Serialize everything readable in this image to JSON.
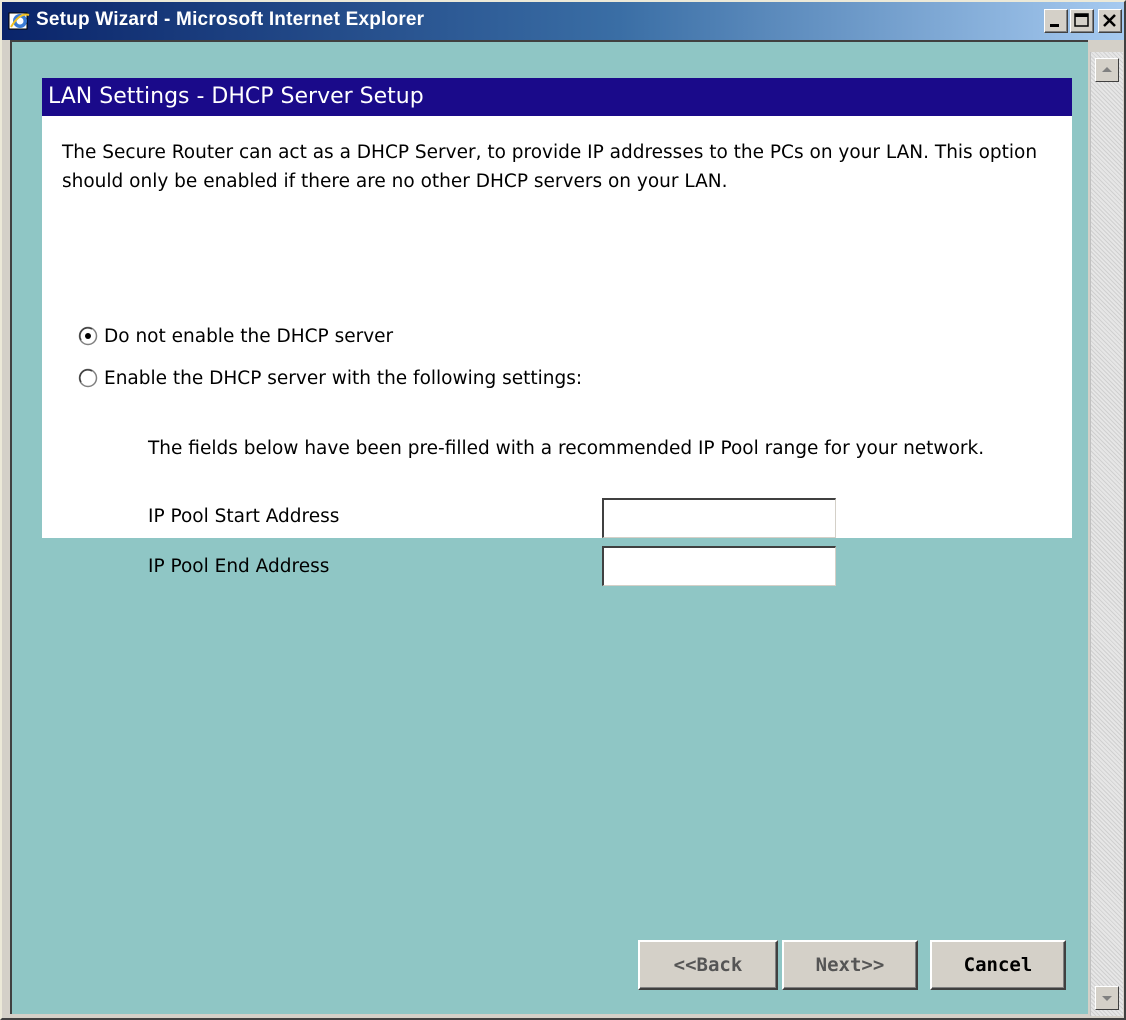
{
  "window": {
    "title": "Setup Wizard - Microsoft Internet Explorer"
  },
  "page": {
    "title": "LAN Settings - DHCP Server Setup",
    "intro": "The Secure Router can act as a DHCP Server, to provide IP addresses to the PCs on your LAN. This option should only be enabled if there are no other DHCP servers on your LAN.",
    "options": [
      {
        "label": "Do not enable the DHCP server",
        "selected": true
      },
      {
        "label": "Enable the DHCP server with the following settings:",
        "selected": false
      }
    ],
    "note": "The fields below have been pre-filled with a recommended IP Pool range for your network.",
    "fields": [
      {
        "label": "IP Pool Start Address",
        "value": ""
      },
      {
        "label": "IP Pool End Address",
        "value": ""
      }
    ]
  },
  "buttons": {
    "back": "<<Back",
    "next": "Next>>",
    "cancel": "Cancel"
  },
  "colors": {
    "title_bar": "#1a0a8a",
    "background": "#8fc6c5"
  }
}
